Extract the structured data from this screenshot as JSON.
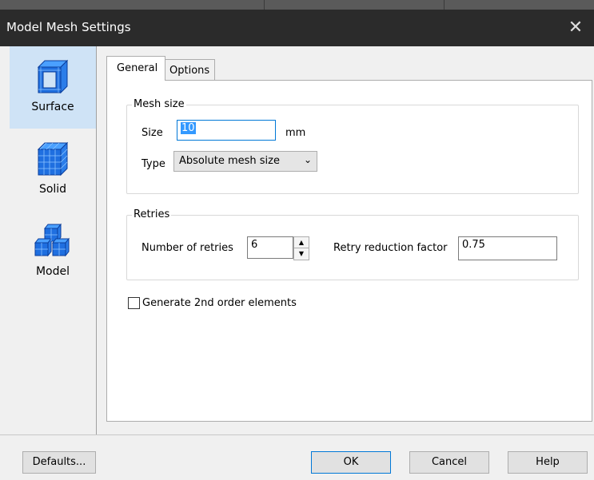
{
  "window": {
    "title": "Model Mesh Settings",
    "close_glyph": "✕"
  },
  "sidebar": {
    "items": [
      {
        "label": "Surface",
        "icon": "surface-mesh-icon",
        "selected": true
      },
      {
        "label": "Solid",
        "icon": "solid-mesh-icon",
        "selected": false
      },
      {
        "label": "Model",
        "icon": "model-mesh-icon",
        "selected": false
      }
    ]
  },
  "tabs": [
    {
      "label": "General",
      "active": true
    },
    {
      "label": "Options",
      "active": false
    }
  ],
  "mesh_size": {
    "group_label": "Mesh size",
    "size_label": "Size",
    "size_value": "10",
    "size_unit": "mm",
    "type_label": "Type",
    "type_value": "Absolute mesh size"
  },
  "retries": {
    "group_label": "Retries",
    "number_label": "Number of retries",
    "number_value": "6",
    "reduction_label": "Retry reduction factor",
    "reduction_value": "0.75"
  },
  "options": {
    "second_order_label": "Generate 2nd order elements",
    "second_order_checked": false
  },
  "buttons": {
    "defaults": "Defaults...",
    "ok": "OK",
    "cancel": "Cancel",
    "help": "Help"
  },
  "colors": {
    "accent": "#0078d7",
    "selected_nav": "#cfe3f6",
    "titlebar": "#2b2b2b",
    "mesh_blue": "#1f6fe0"
  }
}
